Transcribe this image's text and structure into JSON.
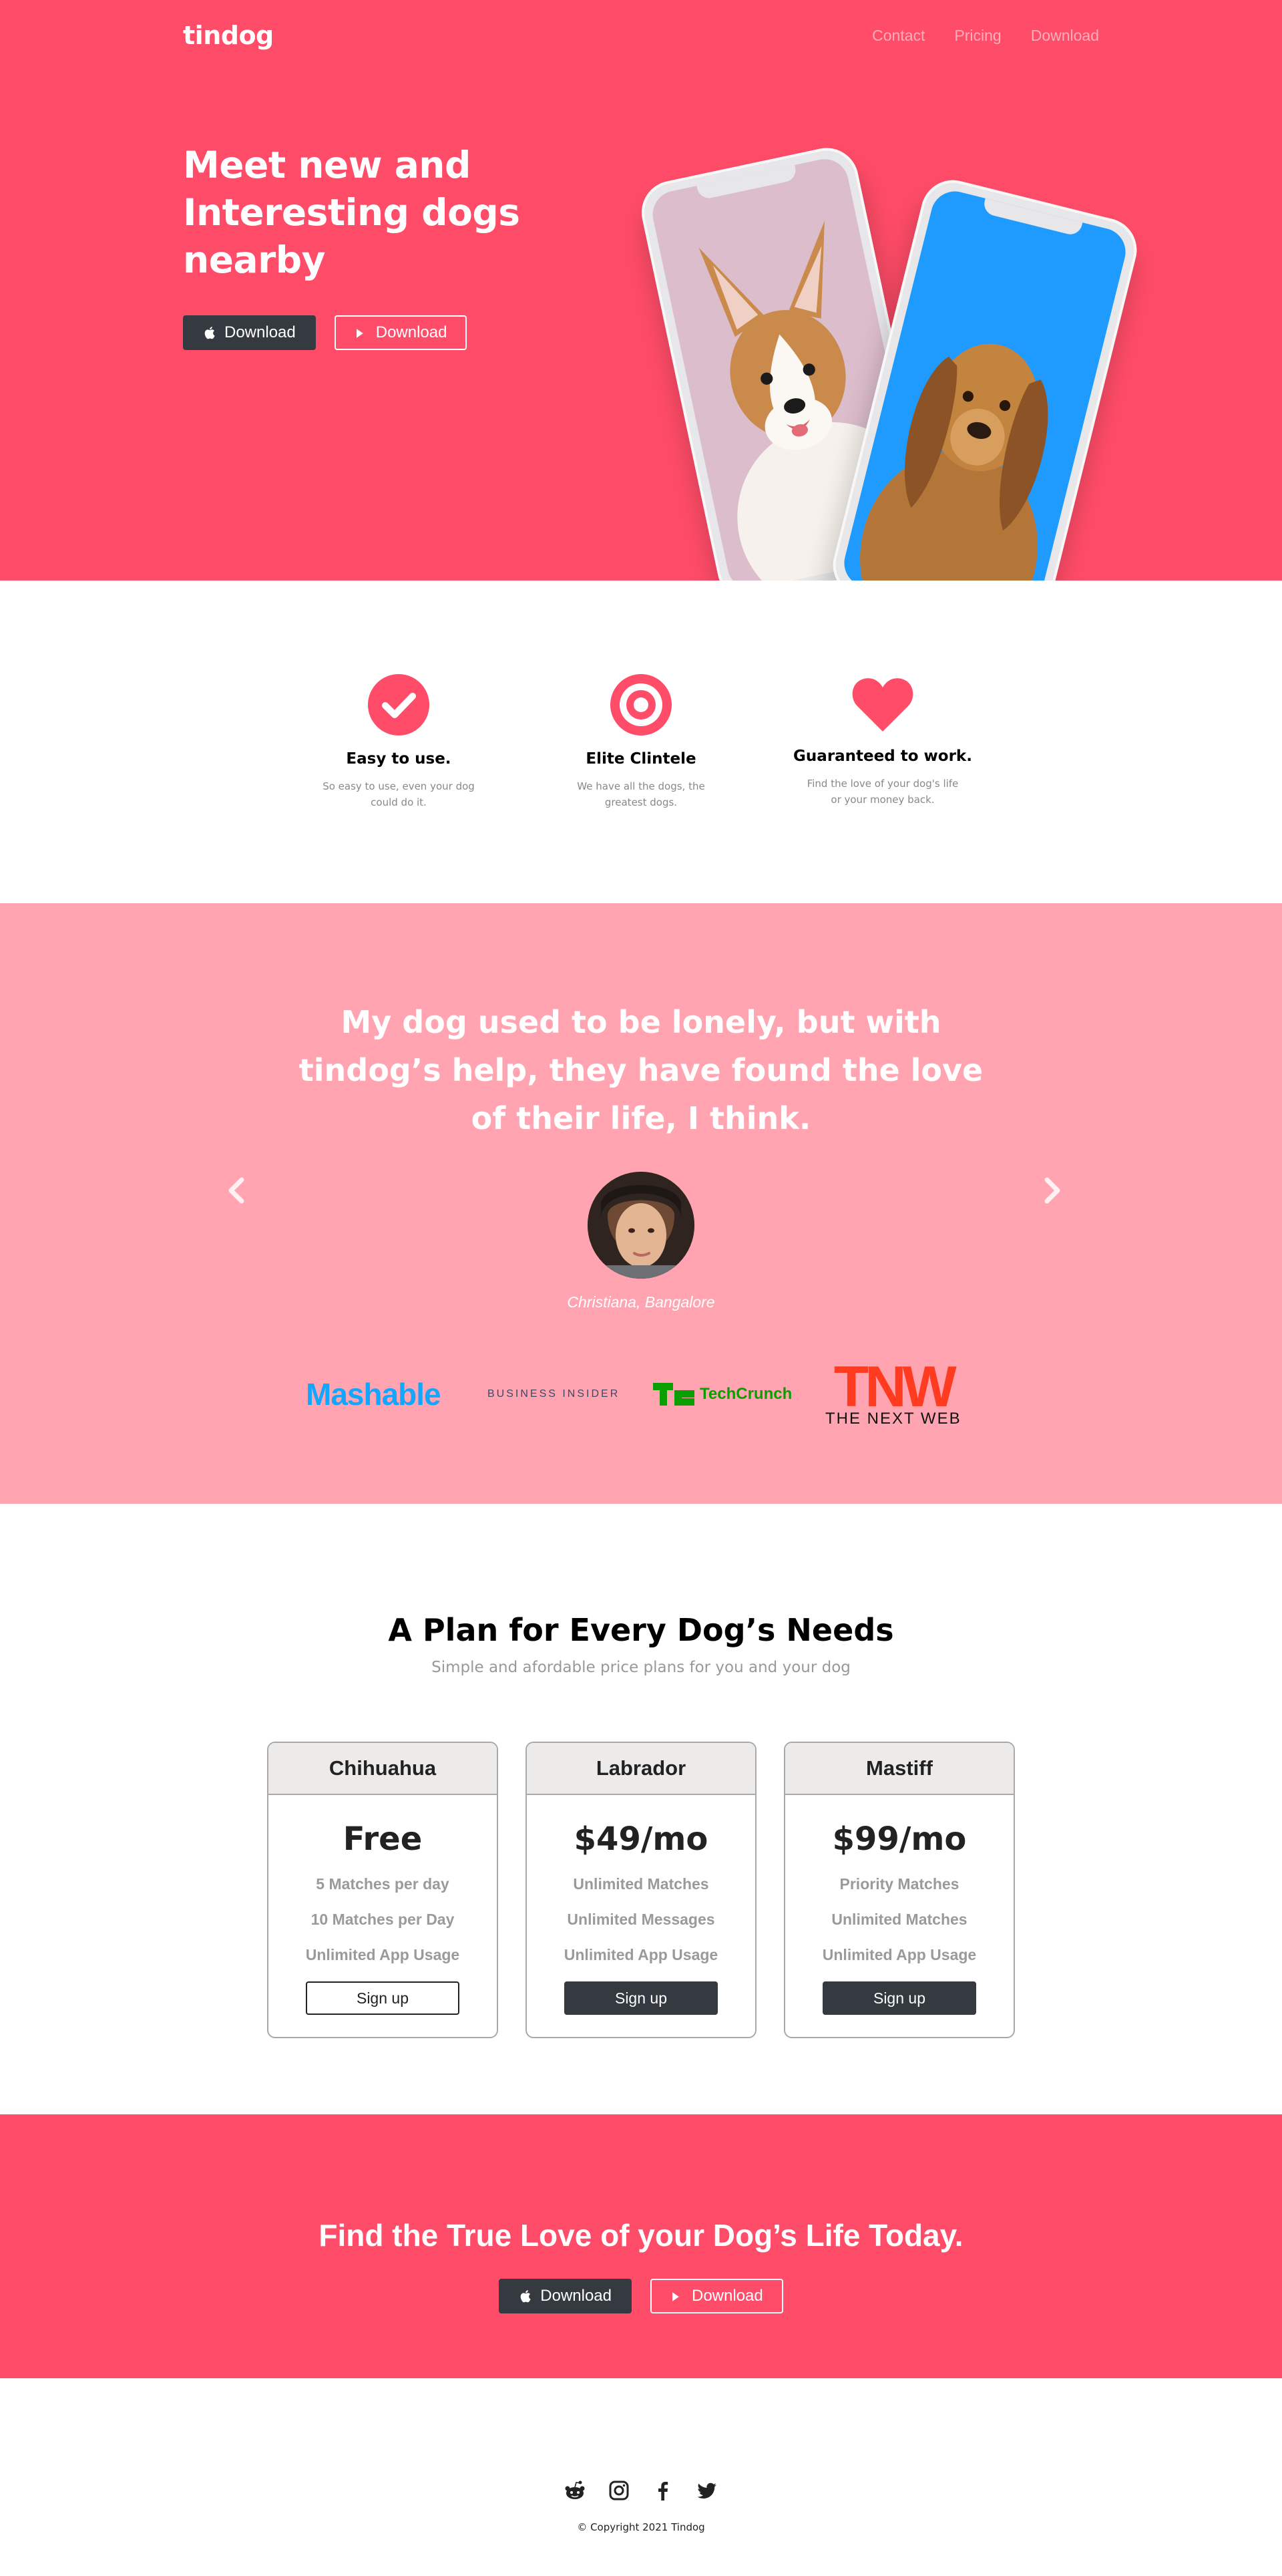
{
  "nav": {
    "brand": "tindog",
    "links": [
      "Contact",
      "Pricing",
      "Download"
    ]
  },
  "hero": {
    "title": "Meet new and Interesting dogs nearby",
    "apple_button": "Download",
    "play_button": "Download"
  },
  "features": [
    {
      "icon": "check-circle-icon",
      "title": "Easy to use.",
      "text": "So easy to use, even your dog could do it."
    },
    {
      "icon": "target-icon",
      "title": "Elite Clintele",
      "text": "We have all the dogs, the greatest dogs."
    },
    {
      "icon": "heart-icon",
      "title": "Guaranteed to work.",
      "text": "Find the love of your dog's life or your money back."
    }
  ],
  "testimonial": {
    "quote": "My dog used to be lonely, but with tindog’s help, they have found the love of their life, I think.",
    "author": "Christiana, Bangalore"
  },
  "press": {
    "mashable": "Mashable",
    "business_insider": "BUSINESS INSIDER",
    "techcrunch": "TechCrunch",
    "tnw_mark": "TNW",
    "tnw_sub": "THE NEXT WEB"
  },
  "pricing": {
    "title": "A Plan for Every Dog’s Needs",
    "subtitle": "Simple and afordable price plans for you and your dog",
    "plans": [
      {
        "name": "Chihuahua",
        "price": "Free",
        "features": [
          "5 Matches per day",
          "10 Matches per Day",
          "Unlimited  App Usage"
        ],
        "button": "Sign up"
      },
      {
        "name": "Labrador",
        "price": "$49/mo",
        "features": [
          "Unlimited Matches",
          "Unlimited Messages",
          "Unlimited  App Usage"
        ],
        "button": "Sign up"
      },
      {
        "name": "Mastiff",
        "price": "$99/mo",
        "features": [
          "Priority Matches",
          "Unlimited Matches",
          "Unlimited  App Usage"
        ],
        "button": "Sign up"
      }
    ]
  },
  "cta": {
    "title": "Find the True Love of your Dog’s Life Today.",
    "apple_button": "Download",
    "play_button": "Download"
  },
  "footer": {
    "social_icons": [
      "reddit-icon",
      "instagram-icon",
      "facebook-icon",
      "twitter-icon"
    ],
    "copyright": "© Copyright 2021 Tindog"
  },
  "colors": {
    "primary": "#ff4c68",
    "testimonial_bg": "#ffa4b0",
    "dark_button": "#343a40"
  }
}
